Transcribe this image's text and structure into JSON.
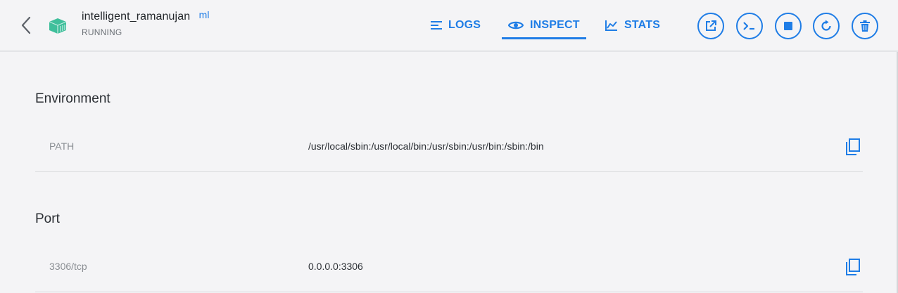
{
  "header": {
    "container_name": "intelligent_ramanujan",
    "image_tag": "ml",
    "status": "RUNNING",
    "back_icon": "chevron-left-icon",
    "container_icon": "container-icon"
  },
  "tabs": [
    {
      "label": "LOGS",
      "icon": "logs-icon",
      "active": false
    },
    {
      "label": "INSPECT",
      "icon": "eye-icon",
      "active": true
    },
    {
      "label": "STATS",
      "icon": "chart-line-icon",
      "active": false
    }
  ],
  "actions": [
    {
      "icon": "open-external-icon"
    },
    {
      "icon": "terminal-icon"
    },
    {
      "icon": "stop-icon"
    },
    {
      "icon": "restart-icon"
    },
    {
      "icon": "trash-icon"
    }
  ],
  "sections": {
    "environment": {
      "title": "Environment",
      "rows": [
        {
          "key": "PATH",
          "value": "/usr/local/sbin:/usr/local/bin:/usr/sbin:/usr/bin:/sbin:/bin"
        }
      ]
    },
    "port": {
      "title": "Port",
      "rows": [
        {
          "key": "3306/tcp",
          "value": "0.0.0.0:3306"
        }
      ]
    }
  },
  "colors": {
    "accent": "#1f7de6",
    "background": "#f4f4f6",
    "container_icon": "#3fbf9b"
  }
}
